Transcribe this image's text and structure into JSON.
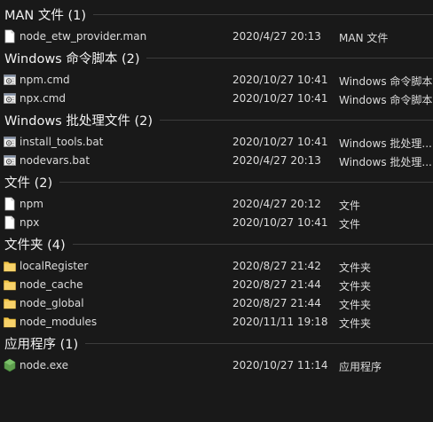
{
  "groups": [
    {
      "title": "MAN 文件 (1)",
      "icon": "file-icon",
      "items": [
        {
          "name": "node_etw_provider.man",
          "date": "2020/4/27 20:13",
          "type": "MAN 文件"
        }
      ]
    },
    {
      "title": "Windows 命令脚本 (2)",
      "icon": "script-icon",
      "items": [
        {
          "name": "npm.cmd",
          "date": "2020/10/27 10:41",
          "type": "Windows 命令脚本"
        },
        {
          "name": "npx.cmd",
          "date": "2020/10/27 10:41",
          "type": "Windows 命令脚本"
        }
      ]
    },
    {
      "title": "Windows 批处理文件 (2)",
      "icon": "script-icon",
      "items": [
        {
          "name": "install_tools.bat",
          "date": "2020/10/27 10:41",
          "type": "Windows 批处理..."
        },
        {
          "name": "nodevars.bat",
          "date": "2020/4/27 20:13",
          "type": "Windows 批处理..."
        }
      ]
    },
    {
      "title": "文件 (2)",
      "icon": "file-icon",
      "items": [
        {
          "name": "npm",
          "date": "2020/4/27 20:12",
          "type": "文件"
        },
        {
          "name": "npx",
          "date": "2020/10/27 10:41",
          "type": "文件"
        }
      ]
    },
    {
      "title": "文件夹 (4)",
      "icon": "folder-icon",
      "items": [
        {
          "name": "localRegister",
          "date": "2020/8/27 21:42",
          "type": "文件夹"
        },
        {
          "name": "node_cache",
          "date": "2020/8/27 21:44",
          "type": "文件夹"
        },
        {
          "name": "node_global",
          "date": "2020/8/27 21:44",
          "type": "文件夹"
        },
        {
          "name": "node_modules",
          "date": "2020/11/11 19:18",
          "type": "文件夹"
        }
      ]
    },
    {
      "title": "应用程序 (1)",
      "icon": "application-icon",
      "items": [
        {
          "name": "node.exe",
          "date": "2020/10/27 11:14",
          "type": "应用程序"
        }
      ]
    }
  ],
  "colors": {
    "background": "#191919",
    "text": "#dcdcdc",
    "header": "#f2f2f2",
    "folder": "#f3c74b",
    "node_green": "#5fa04e"
  }
}
